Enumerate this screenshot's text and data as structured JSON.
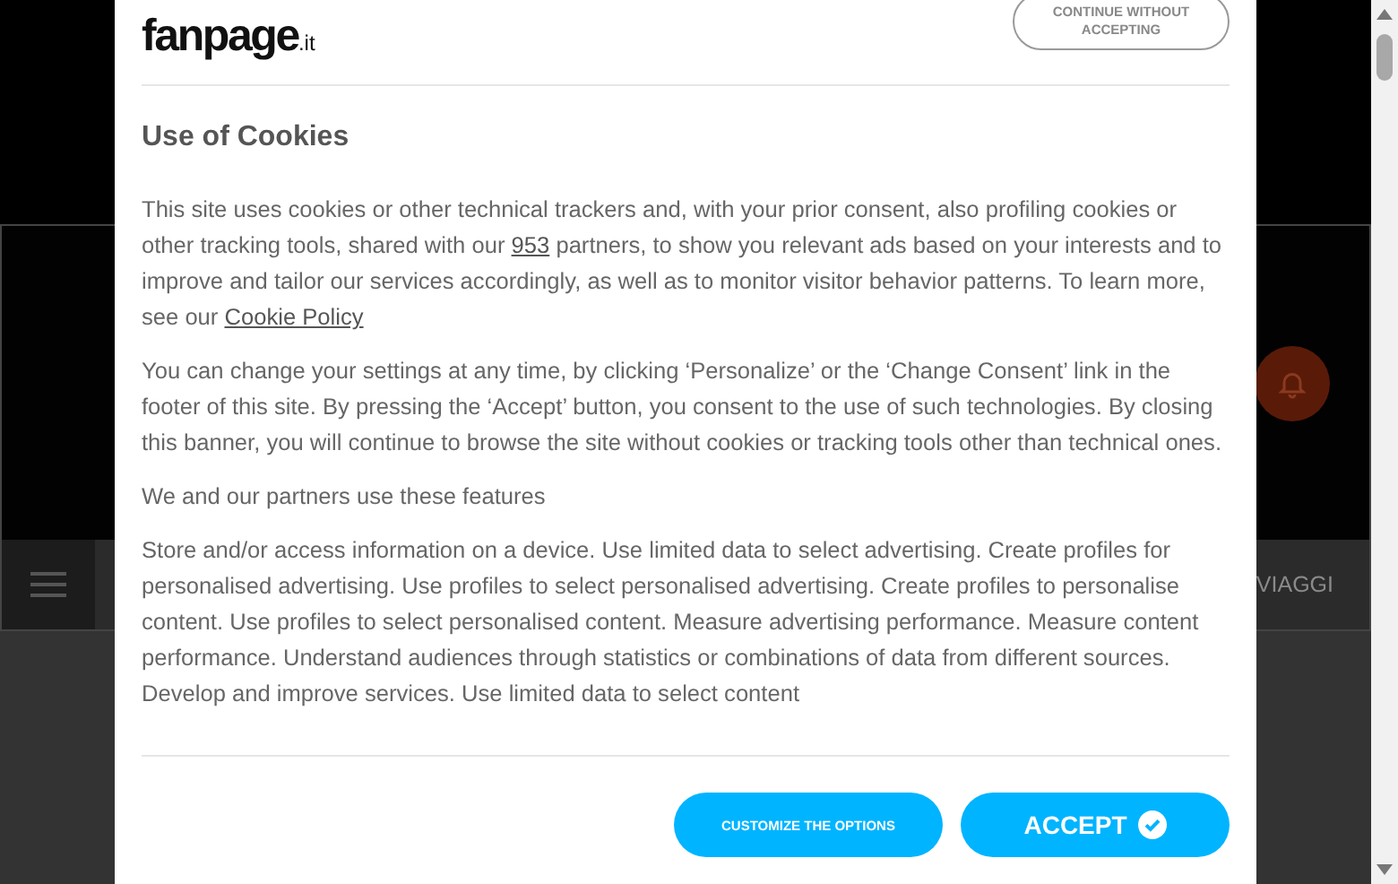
{
  "background": {
    "nav_item": "VIAGGI"
  },
  "dialog": {
    "logo": {
      "name": "fanpage",
      "suffix": ".it"
    },
    "continue_button": "CONTINUE WITHOUT ACCEPTING",
    "title": "Use of Cookies",
    "paragraphs": [
      {
        "parts": [
          {
            "text": "This site uses cookies or other technical trackers and, with your prior consent, also profiling cookies or other tracking tools, shared with our "
          },
          {
            "link": "953"
          },
          {
            "text": " partners, to show you relevant ads based on your interests and to improve and tailor our services accordingly, as well as to monitor visitor behavior patterns. To learn more, see our "
          },
          {
            "link": "Cookie Policy"
          }
        ]
      },
      {
        "parts": [
          {
            "text": "You can change your settings at any time, by clicking ‘Personalize’ or the ‘Change Consent’ link in the footer of this site. By pressing the ‘Accept’ button, you consent to the use of such technologies. By closing this banner, you will continue to browse the site without cookies or tracking tools other than technical ones."
          }
        ]
      },
      {
        "parts": [
          {
            "text": "We and our partners use these features"
          }
        ]
      },
      {
        "parts": [
          {
            "text": "Store and/or access information on a device. Use limited data to select advertising. Create profiles for personalised advertising. Use profiles to select personalised advertising. Create profiles to personalise content. Use profiles to select personalised content. Measure advertising performance. Measure content performance. Understand audiences through statistics or combinations of data from different sources. Develop and improve services. Use limited data to select content"
          }
        ]
      }
    ],
    "customize_button": "CUSTOMIZE THE OPTIONS",
    "accept_button": "ACCEPT"
  }
}
